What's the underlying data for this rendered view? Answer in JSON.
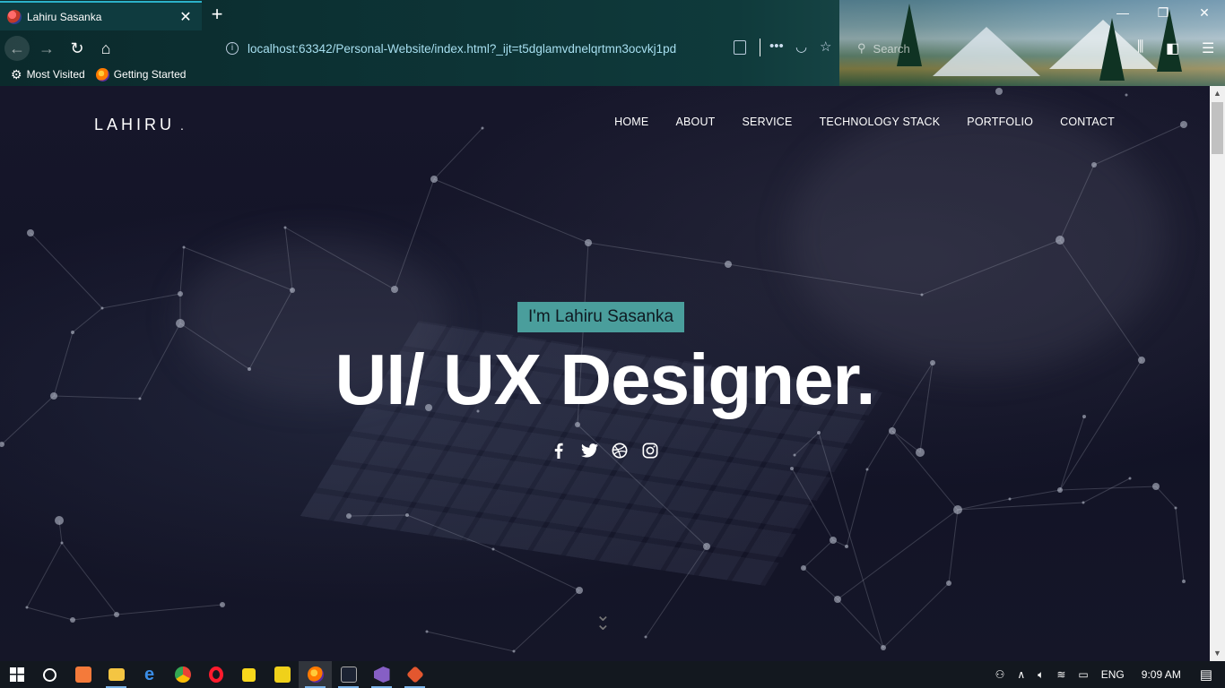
{
  "browser": {
    "tab_title": "Lahiru Sasanka",
    "tab_close": "✕",
    "new_tab": "+",
    "url": "localhost:63342/Personal-Website/index.html?_ijt=t5dglamvdnelqrtmn3ocvkj1pd",
    "search_placeholder": "Search",
    "bookmarks": [
      "Most Visited",
      "Getting Started"
    ]
  },
  "site": {
    "brand": "LAHIRU",
    "brand_dot": ".",
    "nav": [
      "HOME",
      "ABOUT",
      "SERVICE",
      "TECHNOLOGY STACK",
      "PORTFOLIO",
      "CONTACT"
    ],
    "intro": "I'm Lahiru Sasanka",
    "headline": "UI/ UX Designer.",
    "social_icons": [
      "facebook-icon",
      "twitter-icon",
      "dribbble-icon",
      "instagram-icon"
    ],
    "accent_color": "#4a9e9c"
  },
  "taskbar": {
    "language": "ENG",
    "time": "9:09 AM"
  }
}
